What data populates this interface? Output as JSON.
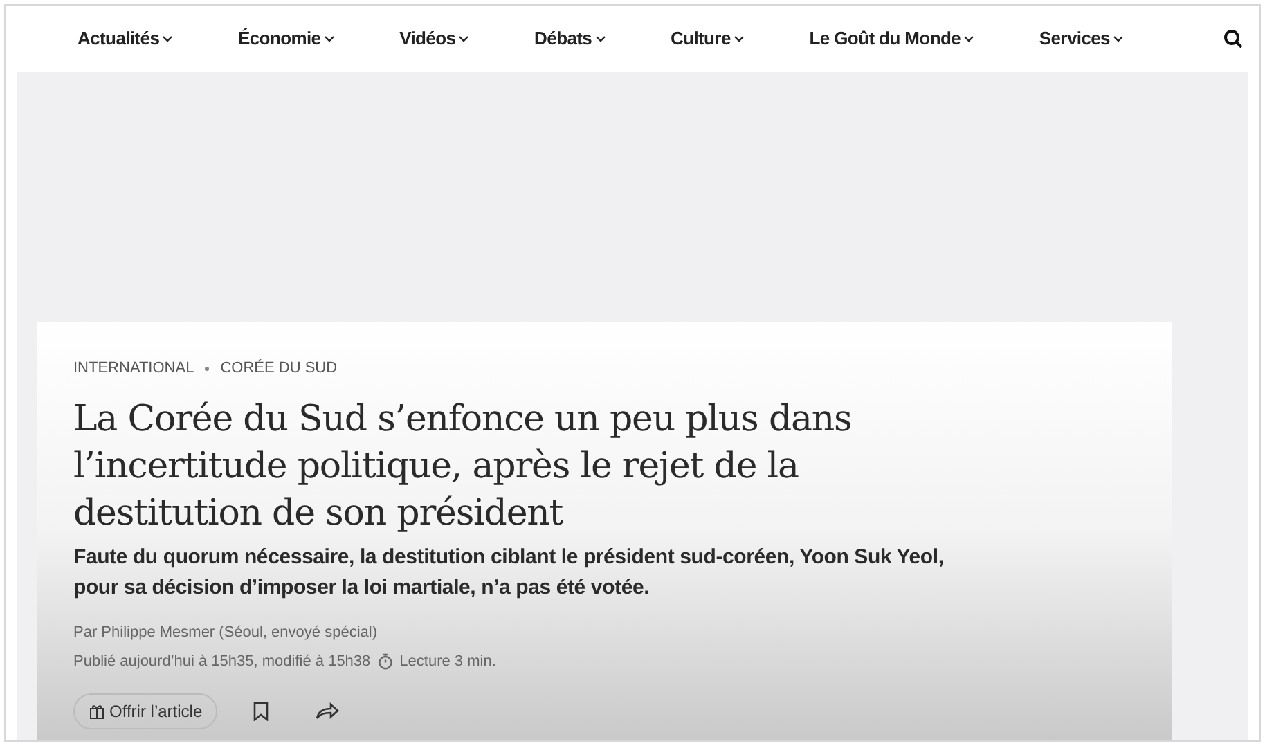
{
  "nav": {
    "items": [
      {
        "label": "Actualités"
      },
      {
        "label": "Économie"
      },
      {
        "label": "Vidéos"
      },
      {
        "label": "Débats"
      },
      {
        "label": "Culture"
      },
      {
        "label": "Le Goût du Monde"
      },
      {
        "label": "Services"
      }
    ]
  },
  "article": {
    "breadcrumb": [
      "INTERNATIONAL",
      "CORÉE DU SUD"
    ],
    "title": "La Corée du Sud s’enfonce un peu plus dans l’incertitude politique, après le rejet de la destitution de son président",
    "lede": "Faute du quorum nécessaire, la destitution ciblant le président sud-coréen, Yoon Suk Yeol, pour sa décision d’imposer la loi martiale, n’a pas été votée.",
    "byline": "Par Philippe Mesmer (Séoul, envoyé spécial)",
    "published": "Publié aujourd’hui à 15h35, modifié à 15h38",
    "reading_time": "Lecture 3 min.",
    "gift_button": "Offrir l’article"
  }
}
